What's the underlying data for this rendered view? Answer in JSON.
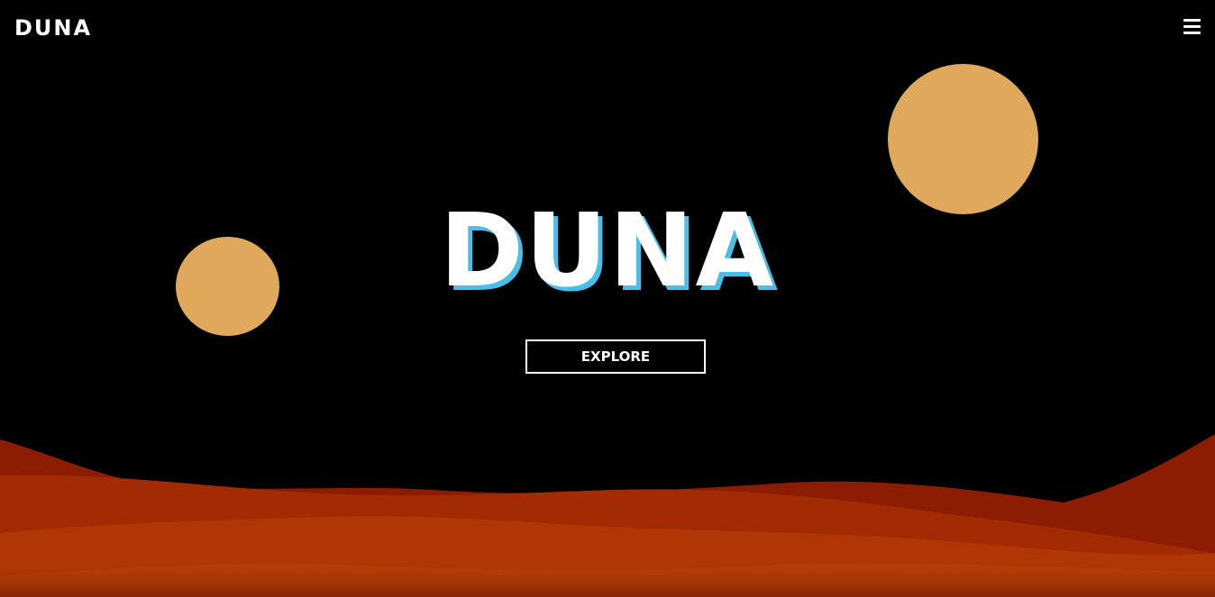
{
  "header": {
    "logo": "DUNA",
    "menu_icon": "hamburger-menu-icon"
  },
  "hero": {
    "title": "DUNA",
    "button_label": "EXPLORE"
  },
  "colors": {
    "background": "#000000",
    "moon": "#dfa85a",
    "title_text": "#ffffff",
    "title_shadow": "#48bfe8",
    "dune_dark": "#8c1d02",
    "dune_mid": "#a22b03",
    "dune_light": "#b13605",
    "dune_bright": "#b83d08"
  }
}
